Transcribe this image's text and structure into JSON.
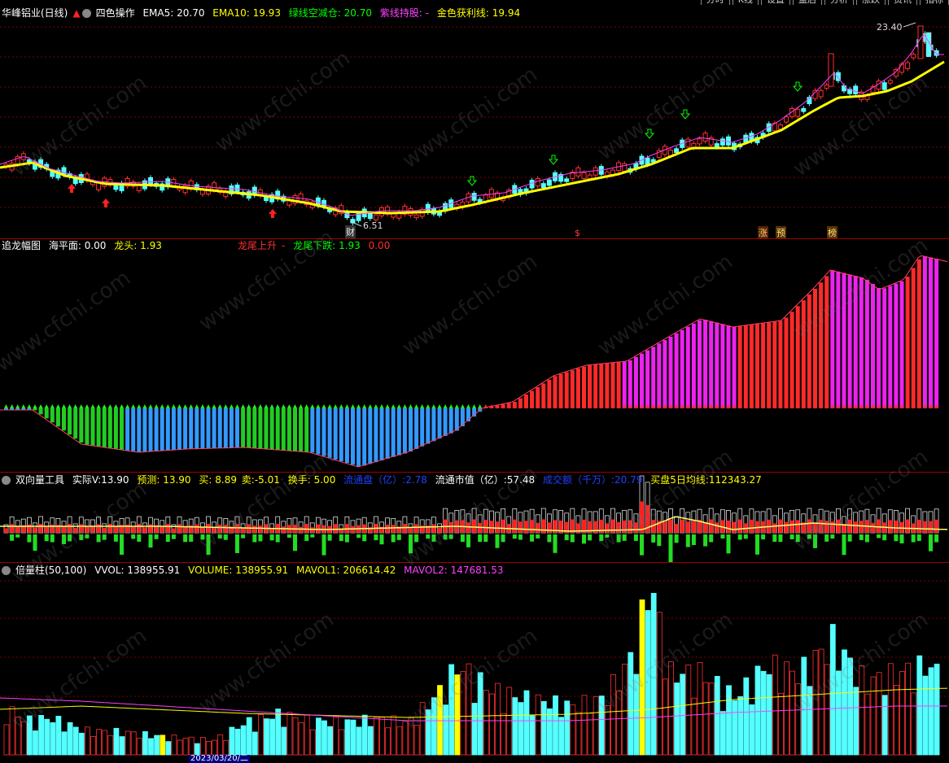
{
  "top_menu": [
    "分时",
    "K线",
    "设置",
    "盘后",
    "分析",
    "涨跌",
    "资讯",
    "指标"
  ],
  "panel1": {
    "title": "华峰铝业(日线)",
    "indicator_name": "四色操作",
    "ema5_label": "EMA5:",
    "ema5": "20.70",
    "ema10_label": "EMA10:",
    "ema10": "19.93",
    "green_label": "绿线空减仓:",
    "green": "20.70",
    "purple_label": "紫线持股:",
    "purple": "-",
    "gold_label": "金色获利线:",
    "gold": "19.94",
    "high_label": "23.40",
    "low_label": "6.51",
    "markers": [
      "财",
      "$",
      "涨",
      "预",
      "榜"
    ],
    "colors": {
      "up": "#ff3030",
      "down": "#54ffff",
      "ema_gold": "#ffff00",
      "buy_arrow": "#ff2020",
      "sell_arrow": "#00ff00"
    }
  },
  "panel2": {
    "name": "追龙幅图",
    "sea_label": "海平面:",
    "sea": "0.00",
    "head_label": "龙头:",
    "head": "1.93",
    "tail_up": "龙尾上升",
    "tail_down_label": "龙尾下跌:",
    "tail_down": "1.93",
    "zero": "0.00"
  },
  "panel3": {
    "name": "双向量工具",
    "actual_label": "实际V:",
    "actual": "13.90",
    "forecast_label": "预测:",
    "forecast": "13.90",
    "buy_label": "买:",
    "buy": "8.89",
    "sell_label": "卖:",
    "sell": "-5.01",
    "turnover_label": "换手:",
    "turnover": "5.00",
    "float_label": "流通盘（亿）:",
    "float": "2.78",
    "mcap_label": "流通市值（亿）:",
    "mcap": "57.48",
    "deal_label": "成交额（千万）:",
    "deal": "20.79",
    "buy5_label": "买盘5日均线:",
    "buy5": "112343.27"
  },
  "panel4": {
    "name": "倍量柱(50,100)",
    "vvol_label": "VVOL:",
    "vvol": "138955.91",
    "volume_label": "VOLUME:",
    "volume": "138955.91",
    "mavol1_label": "MAVOL1:",
    "mavol1": "206614.42",
    "mavol2_label": "MAVOL2:",
    "mavol2": "147681.53",
    "date_label": "2023/03/20/二"
  },
  "watermark": "www.cfchi.com"
}
